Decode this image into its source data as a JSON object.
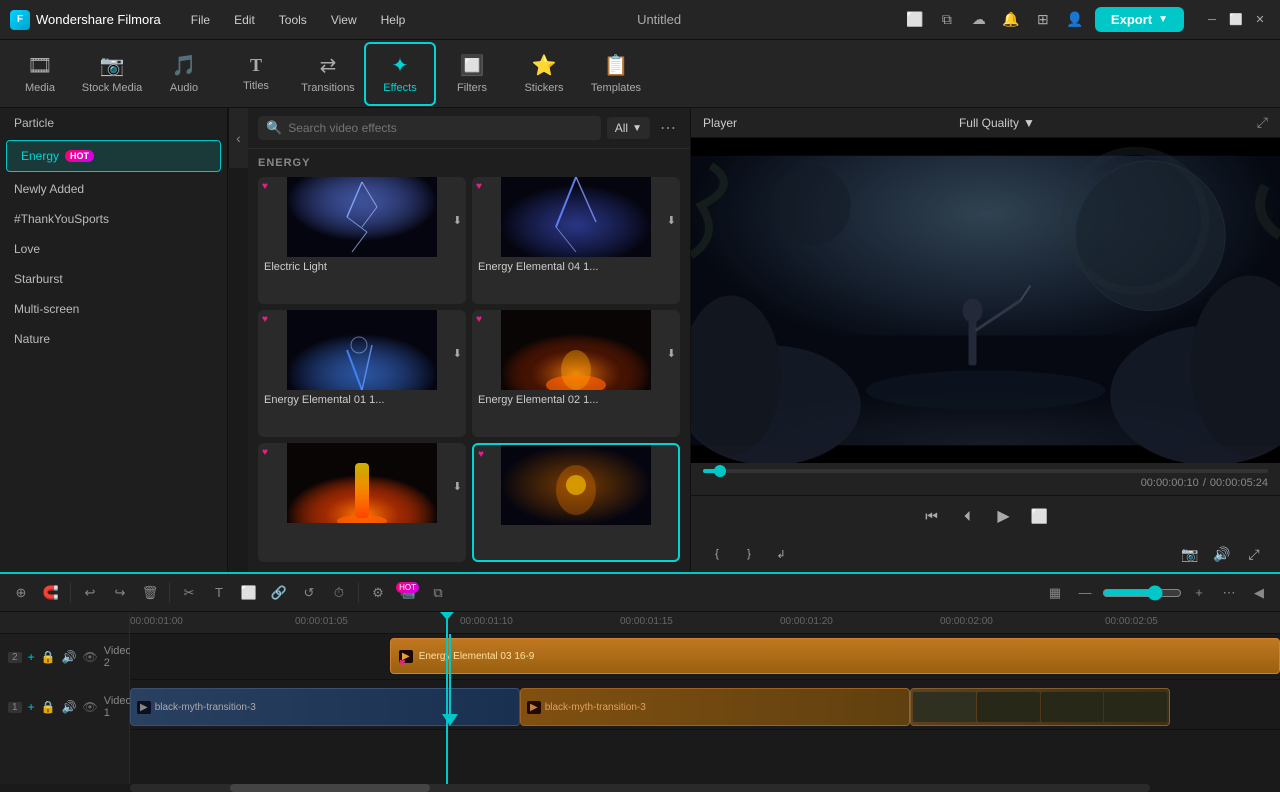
{
  "app": {
    "name": "Wondershare Filmora",
    "title": "Untitled",
    "logo_text": "F"
  },
  "menu": {
    "items": [
      "File",
      "Edit",
      "Tools",
      "View",
      "Help"
    ]
  },
  "nav": {
    "items": [
      {
        "id": "media",
        "label": "Media",
        "icon": "🎞"
      },
      {
        "id": "stock-media",
        "label": "Stock Media",
        "icon": "📷"
      },
      {
        "id": "audio",
        "label": "Audio",
        "icon": "🎵"
      },
      {
        "id": "titles",
        "label": "Titles",
        "icon": "T"
      },
      {
        "id": "transitions",
        "label": "Transitions",
        "icon": "▶"
      },
      {
        "id": "effects",
        "label": "Effects",
        "icon": "✦"
      },
      {
        "id": "filters",
        "label": "Filters",
        "icon": "🔲"
      },
      {
        "id": "stickers",
        "label": "Stickers",
        "icon": "⭐"
      },
      {
        "id": "templates",
        "label": "Templates",
        "icon": "📋"
      }
    ],
    "active": "effects"
  },
  "export_btn": "Export",
  "sidebar": {
    "items": [
      {
        "id": "particle",
        "label": "Particle",
        "active": false
      },
      {
        "id": "energy",
        "label": "Energy",
        "active": true,
        "hot": true
      },
      {
        "id": "newly-added",
        "label": "Newly Added",
        "active": false
      },
      {
        "id": "thankyousports",
        "label": "#ThankYouSports",
        "active": false
      },
      {
        "id": "love",
        "label": "Love",
        "active": false
      },
      {
        "id": "starburst",
        "label": "Starburst",
        "active": false
      },
      {
        "id": "multi-screen",
        "label": "Multi-screen",
        "active": false
      },
      {
        "id": "nature",
        "label": "Nature",
        "active": false
      }
    ]
  },
  "effects_panel": {
    "search_placeholder": "Search video effects",
    "filter_label": "All",
    "section_label": "ENERGY",
    "effects": [
      {
        "id": "electric-light",
        "name": "Electric Light",
        "selected": false,
        "has_fav": true,
        "has_download": true
      },
      {
        "id": "energy-elemental-04",
        "name": "Energy Elemental 04 1...",
        "selected": false,
        "has_fav": true,
        "has_download": true
      },
      {
        "id": "energy-elemental-01",
        "name": "Energy Elemental 01 1...",
        "selected": false,
        "has_fav": true,
        "has_download": true
      },
      {
        "id": "energy-elemental-02",
        "name": "Energy Elemental 02 1...",
        "selected": false,
        "has_fav": true,
        "has_download": true
      },
      {
        "id": "energy-elemental-03",
        "name": "",
        "selected": false,
        "has_fav": true,
        "has_download": true
      },
      {
        "id": "energy-elemental-05",
        "name": "",
        "selected": true,
        "has_fav": true,
        "has_download": false
      }
    ]
  },
  "player": {
    "label": "Player",
    "quality": "Full Quality",
    "time_current": "00:00:00:10",
    "time_total": "00:00:05:24",
    "progress_pct": 3
  },
  "timeline": {
    "tracks": [
      {
        "id": "video2",
        "label": "Video 2",
        "num": 2,
        "clips": [
          {
            "id": "effect-clip",
            "label": "Energy Elemental 03 16-9",
            "type": "effect"
          }
        ]
      },
      {
        "id": "video1",
        "label": "Video 1",
        "num": 1,
        "clips": [
          {
            "id": "clip1",
            "label": "black-myth-transition-3",
            "type": "dark"
          },
          {
            "id": "clip2",
            "label": "black-myth-transition-3",
            "type": "fire"
          },
          {
            "id": "clip3",
            "label": "",
            "type": "dark2"
          }
        ]
      }
    ],
    "ruler_marks": [
      "00:00:01:00",
      "00:00:01:05",
      "00:00:01:10",
      "00:00:01:15",
      "00:00:01:20",
      "00:00:02:00",
      "00:00:02:05"
    ],
    "playhead_time": "00:00:01:10"
  }
}
